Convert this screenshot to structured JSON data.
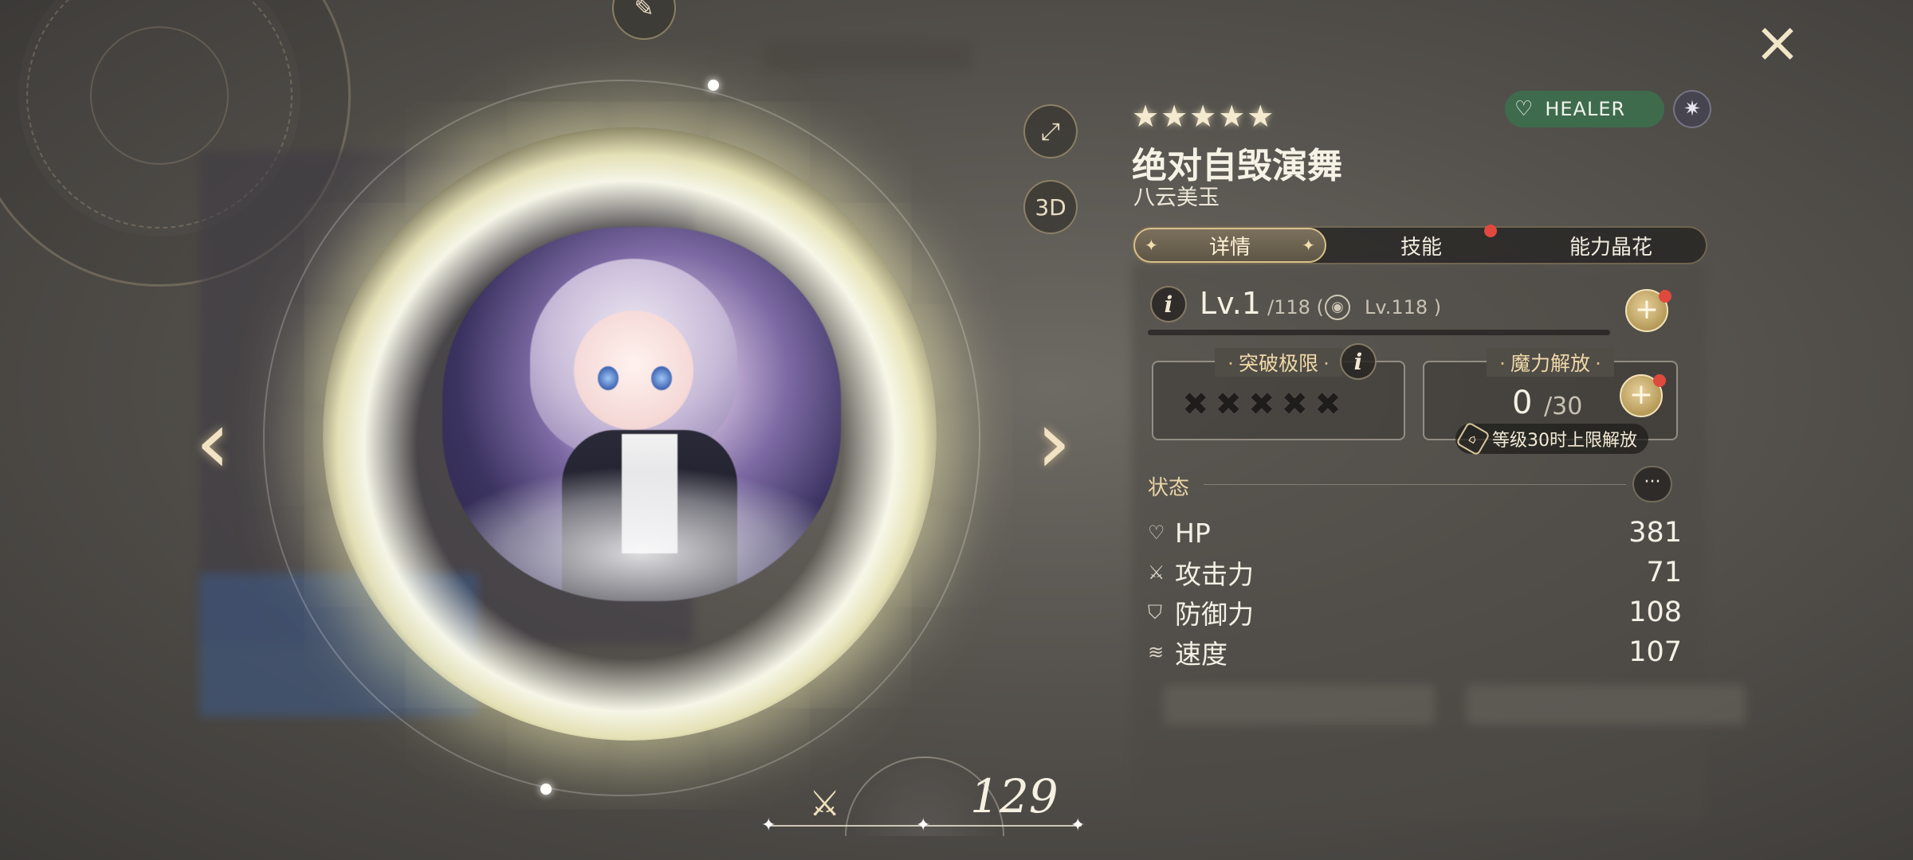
{
  "window": {
    "close_label": "×"
  },
  "card": {
    "rarity_stars": "★★★★★",
    "title": "绝对自毁演舞",
    "character": "八云美玉",
    "role_label": "HEALER",
    "role_color": "#3f6b4d"
  },
  "tabs": [
    {
      "label": "详情",
      "active": true,
      "badge": false
    },
    {
      "label": "技能",
      "active": false,
      "badge": true
    },
    {
      "label": "能力晶花",
      "active": false,
      "badge": false
    }
  ],
  "level": {
    "current": "Lv.1",
    "max": "/118 (",
    "cap": "Lv.118 )",
    "exp_fraction": 0
  },
  "limit_break": {
    "title": "突破极限",
    "clovers": "✖✖✖✖✖",
    "filled": 0,
    "total": 5
  },
  "mana_release": {
    "title": "魔力解放",
    "value": "0",
    "max": "/30",
    "note": "等级30时上限解放"
  },
  "status": {
    "title": "状态",
    "more_label": "···",
    "stats": [
      {
        "icon": "heart-icon",
        "name": "HP",
        "value": "381"
      },
      {
        "icon": "sword-icon",
        "name": "攻击力",
        "value": "71"
      },
      {
        "icon": "shield-icon",
        "name": "防御力",
        "value": "108"
      },
      {
        "icon": "wing-icon",
        "name": "速度",
        "value": "107"
      }
    ]
  },
  "portrait_controls": {
    "three_d_label": "3D"
  },
  "power": {
    "value": "129"
  }
}
